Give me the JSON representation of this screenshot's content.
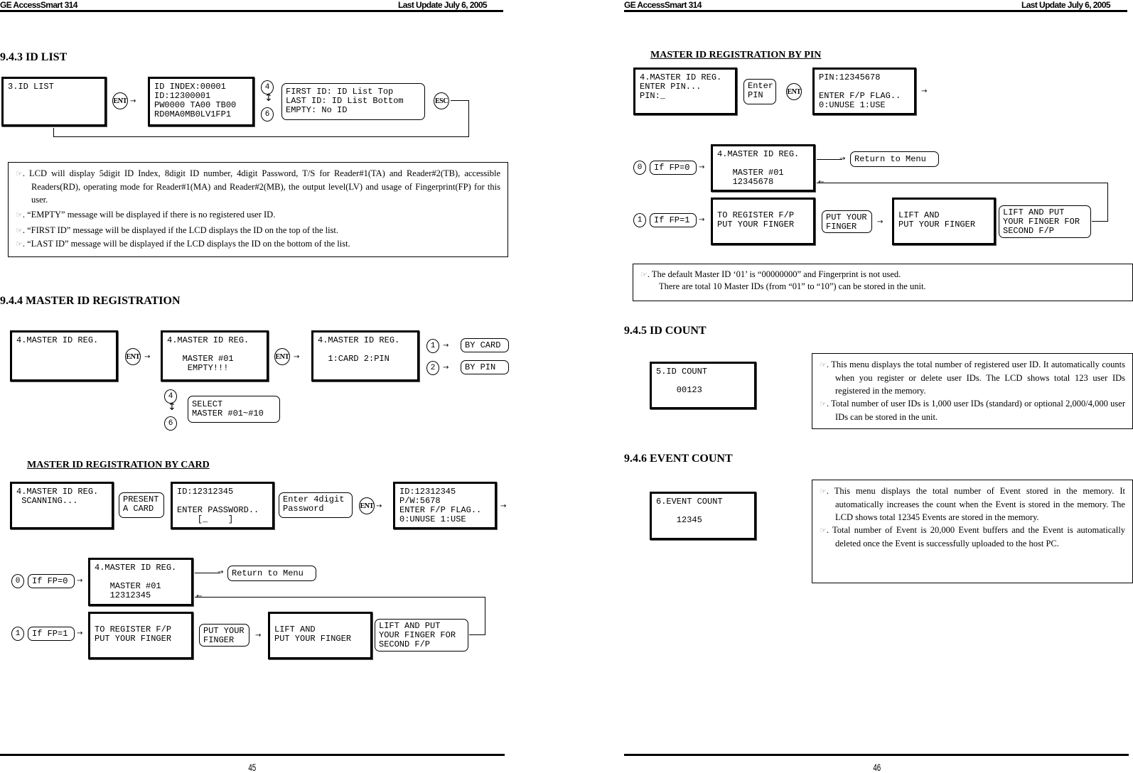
{
  "header": {
    "left_title": "GE AccessSmart 314",
    "right_title": "Last Update July 6, 2005"
  },
  "footer": {
    "left_page": "45",
    "right_page": "46"
  },
  "left_page": {
    "sec_943": {
      "title": "9.4.3 ID LIST",
      "lcd1": "3.ID LIST",
      "key_ent": "ENT",
      "lcd2": "ID INDEX:00001\nID:12300001\nPW0000 TA00 TB00\nRD0MA0MB0LV1FP1",
      "key_4": "4",
      "key_6": "6",
      "info": "FIRST ID: ID List Top\nLAST ID: ID List Bottom\nEMPTY: No ID",
      "key_esc": "ESC",
      "notes": [
        ". LCD will display 5digit ID Index, 8digit ID number, 4digit Password, T/S for Reader#1(TA) and Reader#2(TB), accessible Readers(RD), operating mode for Reader#1(MA) and Reader#2(MB), the output level(LV) and usage of Fingerprint(FP) for this user.",
        ". “EMPTY” message will be displayed if there is no registered user ID.",
        ". “FIRST ID” message will be displayed if the LCD displays the ID on the top of the list.",
        ". “LAST ID” message will be displayed if the LCD displays the ID on the bottom of the list."
      ]
    },
    "sec_944": {
      "title": "9.4.4 MASTER ID REGISTRATION",
      "lcd1": "4.MASTER ID REG.",
      "lcd2": "4.MASTER ID REG.\n\n   MASTER #01\n    EMPTY!!!",
      "lcd3": "4.MASTER ID REG.\n\n  1:CARD 2:PIN",
      "key_ent": "ENT",
      "key_1": "1",
      "key_2": "2",
      "by_card": "BY CARD",
      "by_pin": "BY PIN",
      "key_4": "4",
      "key_6": "6",
      "select": "SELECT\nMASTER #01~#10"
    },
    "by_card": {
      "title": "MASTER ID REGISTRATION BY CARD",
      "lcd1": "4.MASTER ID REG.\n SCANNING...",
      "present": "PRESENT\nA CARD",
      "lcd2": "ID:12312345\n\nENTER PASSWORD..\n    [_    ]",
      "enter_pw": "Enter 4digit\nPassword",
      "key_ent": "ENT",
      "lcd3": "ID:12312345\nP/W:5678\nENTER F/P FLAG..\n0:UNUSE 1:USE",
      "key_0": "0",
      "if_fp0": "If FP=0",
      "lcd_master": "4.MASTER ID REG.\n\n   MASTER #01\n   12312345",
      "return_menu": "Return to Menu",
      "key_1": "1",
      "if_fp1": "If FP=1",
      "lcd_register": "TO REGISTER F/P\nPUT YOUR FINGER",
      "put_finger": "PUT YOUR\nFINGER",
      "lcd_lift": "LIFT AND\nPUT YOUR FINGER",
      "lift_second": "LIFT AND PUT\nYOUR FINGER FOR\nSECOND F/P"
    }
  },
  "right_page": {
    "by_pin": {
      "title": "MASTER ID REGISTRATION BY PIN",
      "lcd1": "4.MASTER ID REG.\nENTER PIN...\nPIN:_",
      "enter_pin": "Enter\nPIN",
      "key_ent": "ENT",
      "lcd2": "PIN:12345678\n\nENTER F/P FLAG..\n0:UNUSE 1:USE",
      "key_0": "0",
      "if_fp0": "If FP=0",
      "lcd_master": "4.MASTER ID REG.\n\n   MASTER #01\n   12345678",
      "return_menu": "Return to Menu",
      "key_1": "1",
      "if_fp1": "If FP=1",
      "lcd_register": "TO REGISTER F/P\nPUT YOUR FINGER",
      "put_finger": "PUT YOUR\nFINGER",
      "lcd_lift": "LIFT AND\nPUT YOUR FINGER",
      "lift_second": "LIFT AND PUT\nYOUR FINGER FOR\nSECOND F/P",
      "notes": [
        ". The default Master ID ‘01’ is “00000000” and Fingerprint is not used.",
        "There are total 10 Master IDs (from “01” to “10”) can be stored in the unit."
      ]
    },
    "sec_945": {
      "title": "9.4.5 ID COUNT",
      "lcd": "5.ID COUNT\n\n    00123",
      "notes": [
        ". This menu displays the total number of registered user ID. It automatically counts when you register or delete user IDs. The LCD shows total 123 user IDs registered in the memory.",
        ". Total number of user IDs is 1,000 user IDs (standard) or optional 2,000/4,000 user IDs can be stored in the unit."
      ]
    },
    "sec_946": {
      "title": "9.4.6 EVENT COUNT",
      "lcd": "6.EVENT COUNT\n\n    12345",
      "notes": [
        ". This menu displays the total number of Event stored in the memory. It automatically increases the count when the Event is stored in the memory. The LCD shows total 12345 Events are stored in the memory.",
        ". Total number of Event is 20,000 Event buffers and the Event is automatically deleted once the Event is successfully uploaded to the host PC."
      ]
    }
  }
}
